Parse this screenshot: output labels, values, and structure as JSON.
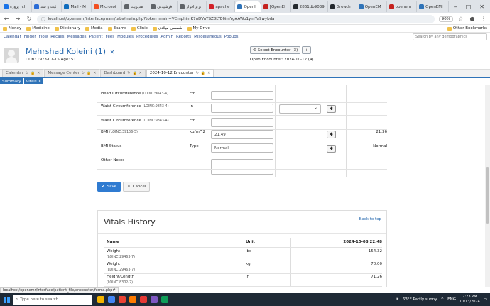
{
  "browser": {
    "tabs": [
      {
        "label": "پروژه rch",
        "color": "#1a73e8",
        "active": false
      },
      {
        "label": "ثبت و سد",
        "color": "#2a6cd6",
        "active": false
      },
      {
        "label": "Mail - M",
        "color": "#0f6cbd",
        "active": false
      },
      {
        "label": "Microsof",
        "color": "#f25022",
        "active": false
      },
      {
        "label": "مدیریت",
        "color": "#5f6368",
        "active": false
      },
      {
        "label": "فرشیدنی",
        "color": "#5f6368",
        "active": false
      },
      {
        "label": "ترم افزار",
        "color": "#5f6368",
        "active": false
      },
      {
        "label": "apache",
        "color": "#d22128",
        "active": false
      },
      {
        "label": "OpenI",
        "color": "#2f73b8",
        "active": true
      },
      {
        "label": "[OpenEI",
        "color": "#c5221f",
        "active": false
      },
      {
        "label": "2861db9039",
        "color": "#24292e",
        "active": false
      },
      {
        "label": "Growth",
        "color": "#24292e",
        "active": false
      },
      {
        "label": "OpenEM",
        "color": "#2f73b8",
        "active": false
      },
      {
        "label": "openem",
        "color": "#c5221f",
        "active": false
      },
      {
        "label": "OpenEMI",
        "color": "#2f73b8",
        "active": false
      }
    ],
    "window_controls": [
      "–",
      "□",
      "✕"
    ],
    "url": "localhost/openemr/interface/main/tabs/main.php?token_main=VCmphimK7nDVuTSZ8LTE6imYgAAWo1ymYu9wybda",
    "zoom": "90%",
    "bookmarks": [
      "Money",
      "Medicine",
      "Dictionary",
      "Media",
      "Exams",
      "Clinic",
      "شمسی میلادی",
      "My Drive"
    ],
    "other_bookmarks": "Other Bookmarks"
  },
  "menu": {
    "items": [
      "Calendar",
      "Finder",
      "Flow",
      "Recalls",
      "Messages",
      "Patient",
      "Fees",
      "Modules",
      "Procedures",
      "Admin",
      "Reports",
      "Miscellaneous",
      "Popups"
    ],
    "search_placeholder": "Search by any demographics"
  },
  "patient": {
    "name": "Mehrshad Koleini",
    "count": "(1)",
    "close": "✕",
    "dob_line": "DOB: 1973-07-15 Age: 51",
    "select_encounter": "Select Encounter",
    "encounter_count": "(3)",
    "open_encounter": "Open Encounter: 2024-10-12 (4)"
  },
  "encounter_tabs": [
    {
      "label": "Calendar",
      "active": false
    },
    {
      "label": "Message Center",
      "active": false
    },
    {
      "label": "Dashboard",
      "active": false
    },
    {
      "label": "2024-10-12 Encounter",
      "active": true
    }
  ],
  "subtabs": [
    {
      "label": "Summary",
      "close": ""
    },
    {
      "label": "Vitals",
      "close": "✕"
    }
  ],
  "vitals_form": {
    "rows": [
      {
        "label": "Head Circumference",
        "loinc": "(LOINC:9843-4)",
        "unit": "cm",
        "value": "",
        "has_select": false,
        "has_button": false,
        "prev": ""
      },
      {
        "label": "Waist Circumference",
        "loinc": "(LOINC:9843-4)",
        "unit": "in",
        "value": "",
        "has_select": true,
        "has_button": true,
        "prev": ""
      },
      {
        "label": "Waist Circumference",
        "loinc": "(LOINC:9843-4)",
        "unit": "cm",
        "value": "",
        "has_select": false,
        "has_button": false,
        "prev": ""
      },
      {
        "label": "BMI",
        "loinc": "(LOINC:39156-5)",
        "unit": "kg/m^2",
        "value": "21.49",
        "has_select": false,
        "has_button": true,
        "prev": "21.36"
      },
      {
        "label": "BMI Status",
        "loinc": "",
        "unit": "Type",
        "value": "Normal",
        "has_select": false,
        "has_button": true,
        "prev": "Normal"
      },
      {
        "label": "Other Notes",
        "loinc": "",
        "unit": "",
        "value": "",
        "has_select": false,
        "has_button": false,
        "prev": ""
      }
    ],
    "save_label": "Save",
    "cancel_label": "Cancel"
  },
  "history": {
    "title": "Vitals History",
    "back_to_top": "Back to top",
    "headers": {
      "name": "Name",
      "unit": "Unit",
      "date": "2024-10-08 22:48"
    },
    "rows": [
      {
        "name": "Weight",
        "loinc": "(LOINC:29463-7)",
        "unit": "lbs",
        "value": "154.32"
      },
      {
        "name": "Weight",
        "loinc": "(LOINC:29463-7)",
        "unit": "kg",
        "value": "70.00"
      },
      {
        "name": "Height/Length",
        "loinc": "(LOINC:8302-2)",
        "unit": "in",
        "value": "71.26"
      }
    ]
  },
  "status_url": "localhost/openemr/interface/patient_file/encounter/forms.php#",
  "taskbar": {
    "search_placeholder": "Type here to search",
    "weather": "63°F  Partly sunny",
    "lang": "ENG",
    "time": "7:23 PM",
    "date": "10/13/2024",
    "app_colors": [
      "#f4b400",
      "#4285f4",
      "#ea4335",
      "#ff7b00",
      "#e53935",
      "#7e57c2",
      "#0f9d58"
    ]
  },
  "colors": {
    "accent": "#2f73b8",
    "link": "#2b6cb0",
    "save": "#2f7bd1"
  }
}
